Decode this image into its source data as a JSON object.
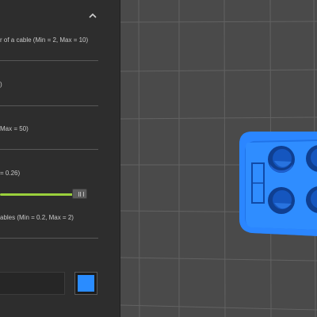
{
  "panel": {
    "collapse_icon": "chevron-up-icon",
    "fields": [
      {
        "label": "r of a cable (Min = 2, Max = 10)"
      },
      {
        "label": ")"
      },
      {
        "label": "Max = 50)"
      },
      {
        "label": "= 0.26)"
      },
      {
        "label": "ables (Min = 0.2, Max = 2)"
      }
    ],
    "slider": {
      "value_fraction": 0.85
    },
    "text_input": {
      "value": ""
    },
    "color": {
      "value": "#2a8cff"
    }
  },
  "viewport": {
    "background": "#4a4a4a",
    "grid_color": "#626262",
    "model_color": "#2a8cff"
  }
}
